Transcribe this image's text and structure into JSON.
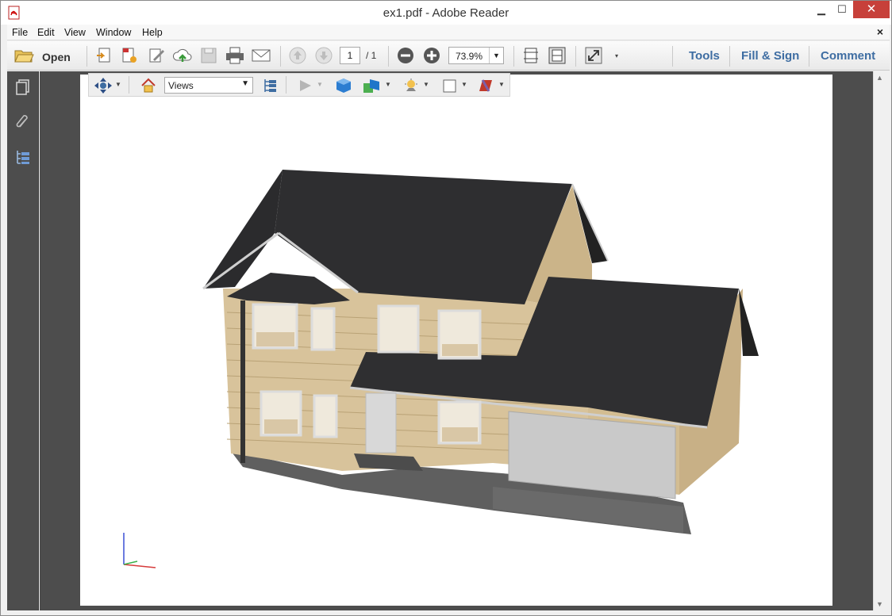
{
  "window": {
    "title": "ex1.pdf - Adobe Reader",
    "min_icon": "▁",
    "max_icon": "☐",
    "close_icon": "✕"
  },
  "menu": {
    "items": [
      "File",
      "Edit",
      "View",
      "Window",
      "Help"
    ],
    "close_doc": "×"
  },
  "toolbar": {
    "open_label": "Open",
    "page_current": "1",
    "page_total": "/ 1",
    "zoom": "73.9%",
    "tabs": [
      "Tools",
      "Fill & Sign",
      "Comment"
    ]
  },
  "toolbar3d": {
    "views_label": "Views"
  },
  "colors": {
    "accent": "#3e6da2",
    "close": "#c7403a",
    "panel": "#4d4d4d"
  }
}
